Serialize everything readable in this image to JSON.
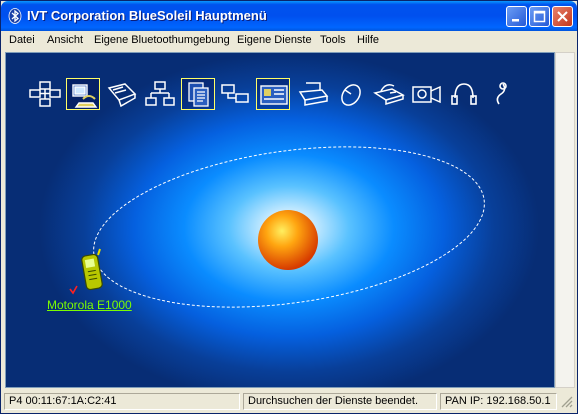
{
  "window": {
    "title": "IVT Corporation BlueSoleil Hauptmenü"
  },
  "menu": [
    {
      "label": "Datei"
    },
    {
      "label": "Ansicht"
    },
    {
      "label": "Eigene Bluetoothumgebung"
    },
    {
      "label": "Eigene Dienste"
    },
    {
      "label": "Tools"
    },
    {
      "label": "Hilfe"
    }
  ],
  "services": [
    {
      "name": "network-service-icon",
      "active": false
    },
    {
      "name": "dialup-service-icon",
      "active": true
    },
    {
      "name": "serial-port-service-icon",
      "active": false
    },
    {
      "name": "lan-access-service-icon",
      "active": false
    },
    {
      "name": "file-transfer-service-icon",
      "active": true
    },
    {
      "name": "personal-area-network-icon",
      "active": false
    },
    {
      "name": "business-card-service-icon",
      "active": true
    },
    {
      "name": "printer-service-icon",
      "active": false
    },
    {
      "name": "mouse-service-icon",
      "active": false
    },
    {
      "name": "fax-service-icon",
      "active": false
    },
    {
      "name": "camera-service-icon",
      "active": false
    },
    {
      "name": "headset-service-icon",
      "active": false
    },
    {
      "name": "headphone-service-icon",
      "active": false
    }
  ],
  "device": {
    "label": "Motorola E1000",
    "icon": "mobile-phone-icon",
    "label_color": "#7CFC00"
  },
  "status": {
    "address": "P4 00:11:67:1A:C2:41",
    "message": "Durchsuchen der Dienste beendet.",
    "pan_ip": "PAN IP:  192.168.50.1"
  },
  "colors": {
    "title_bar": "#0054E3",
    "background_center": "#FFFFFF",
    "background_edge": "#072D75",
    "orbit": "#FFFFFF",
    "active_service_border": "#FFFF66"
  }
}
